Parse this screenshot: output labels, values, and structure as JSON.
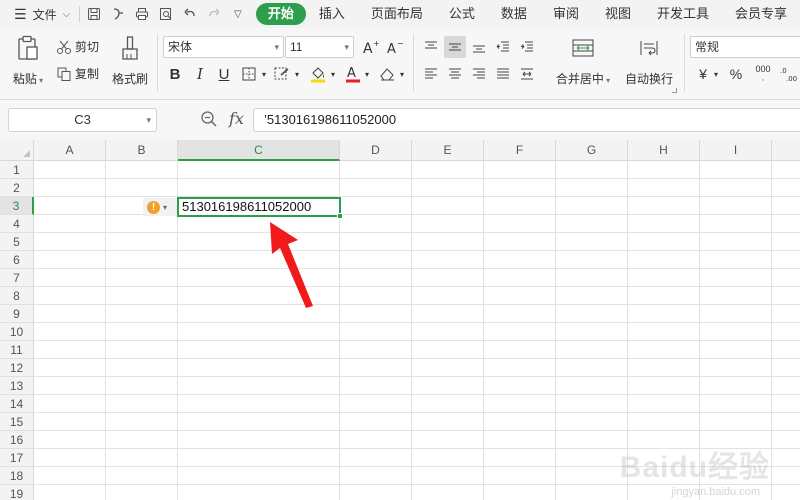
{
  "menu": {
    "file_label": "文件",
    "tabs": [
      {
        "label": "开始",
        "active": true
      },
      {
        "label": "插入"
      },
      {
        "label": "页面布局"
      },
      {
        "label": "公式"
      },
      {
        "label": "数据"
      },
      {
        "label": "审阅"
      },
      {
        "label": "视图"
      },
      {
        "label": "开发工具"
      },
      {
        "label": "会员专享"
      }
    ]
  },
  "ribbon": {
    "paste_label": "粘贴",
    "cut_label": "剪切",
    "copy_label": "复制",
    "format_painter_label": "格式刷",
    "font_name": "宋体",
    "font_size": "11",
    "merge_label": "合并居中",
    "wrap_label": "自动换行",
    "number_format": "常规",
    "currency_symbol": "¥",
    "percent_symbol": "%",
    "thousands_symbol": "000"
  },
  "formula_bar": {
    "name_box": "C3",
    "fx_label": "fx",
    "content": "’513016198611052000"
  },
  "sheet": {
    "columns": [
      "A",
      "B",
      "C",
      "D",
      "E",
      "F",
      "G",
      "H",
      "I"
    ],
    "selected_column": "C",
    "rows": [
      "1",
      "2",
      "3",
      "4",
      "5",
      "6",
      "7",
      "8",
      "9",
      "10",
      "11",
      "12",
      "13",
      "14",
      "15",
      "16",
      "17",
      "18",
      "19"
    ],
    "selected_row": "3",
    "active_cell_value": "513016198611052000"
  },
  "watermark": {
    "text": "Baidu经验",
    "sub": "jingyan.baidu.com"
  },
  "colors": {
    "accent": "#2e9e4c",
    "error_indicator": "#f0a12b",
    "annotation_arrow": "#f01a1a"
  }
}
